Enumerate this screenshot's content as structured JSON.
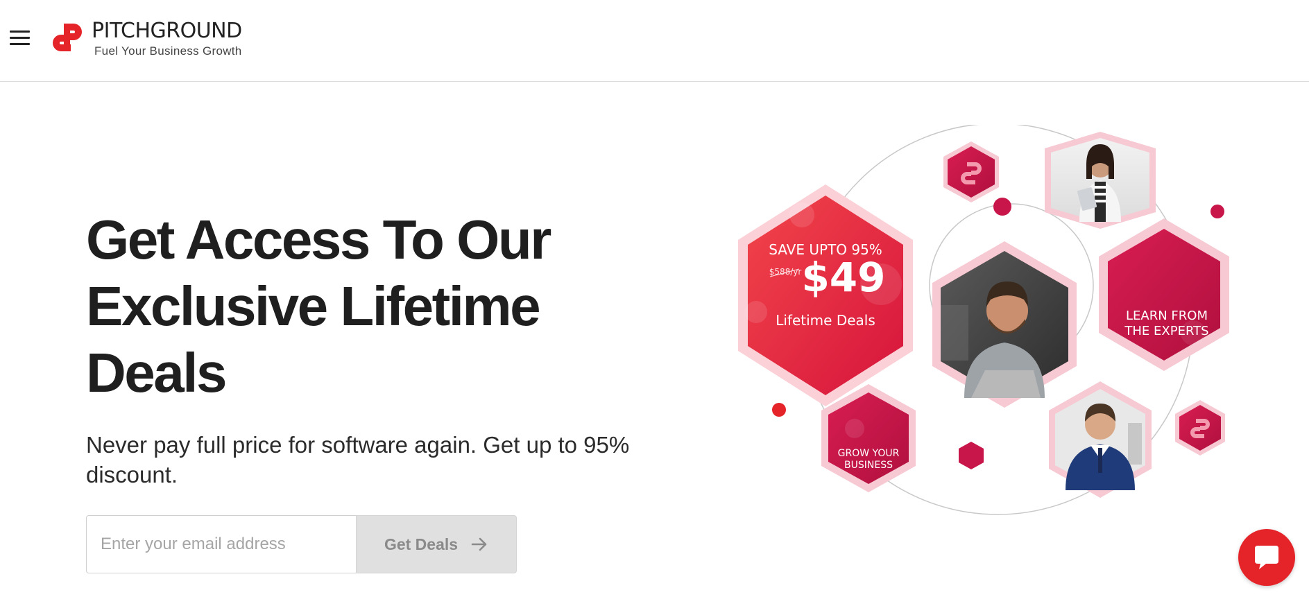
{
  "header": {
    "brand_name": "PITCHGROUND",
    "tagline": "Fuel Your Business Growth",
    "menu_icon": "hamburger-menu-icon",
    "logo_icon": "pitchground-logo-icon"
  },
  "hero": {
    "title_line1": "Get Access To Our",
    "title_line2": "Exclusive Lifetime",
    "title_line3": "Deals",
    "subtitle": "Never pay full price for software again. Get up to 95% discount.",
    "email_placeholder": "Enter your email address",
    "cta_label": "Get Deals",
    "cta_icon": "arrow-right-icon"
  },
  "illustration": {
    "save_text": "SAVE UPTO 95%",
    "old_price": "$588/yr",
    "price": "$49",
    "deal_label": "Lifetime Deals",
    "learn_line1": "LEARN FROM",
    "learn_line2": "THE EXPERTS",
    "grow_line1": "GROW YOUR",
    "grow_line2": "BUSINESS"
  },
  "chat": {
    "icon": "chat-bubble-icon"
  },
  "colors": {
    "brand_red": "#e5242a",
    "crimson": "#c8164a",
    "hex_border": "#f6c9d3",
    "button_grey": "#e0e0e0"
  }
}
